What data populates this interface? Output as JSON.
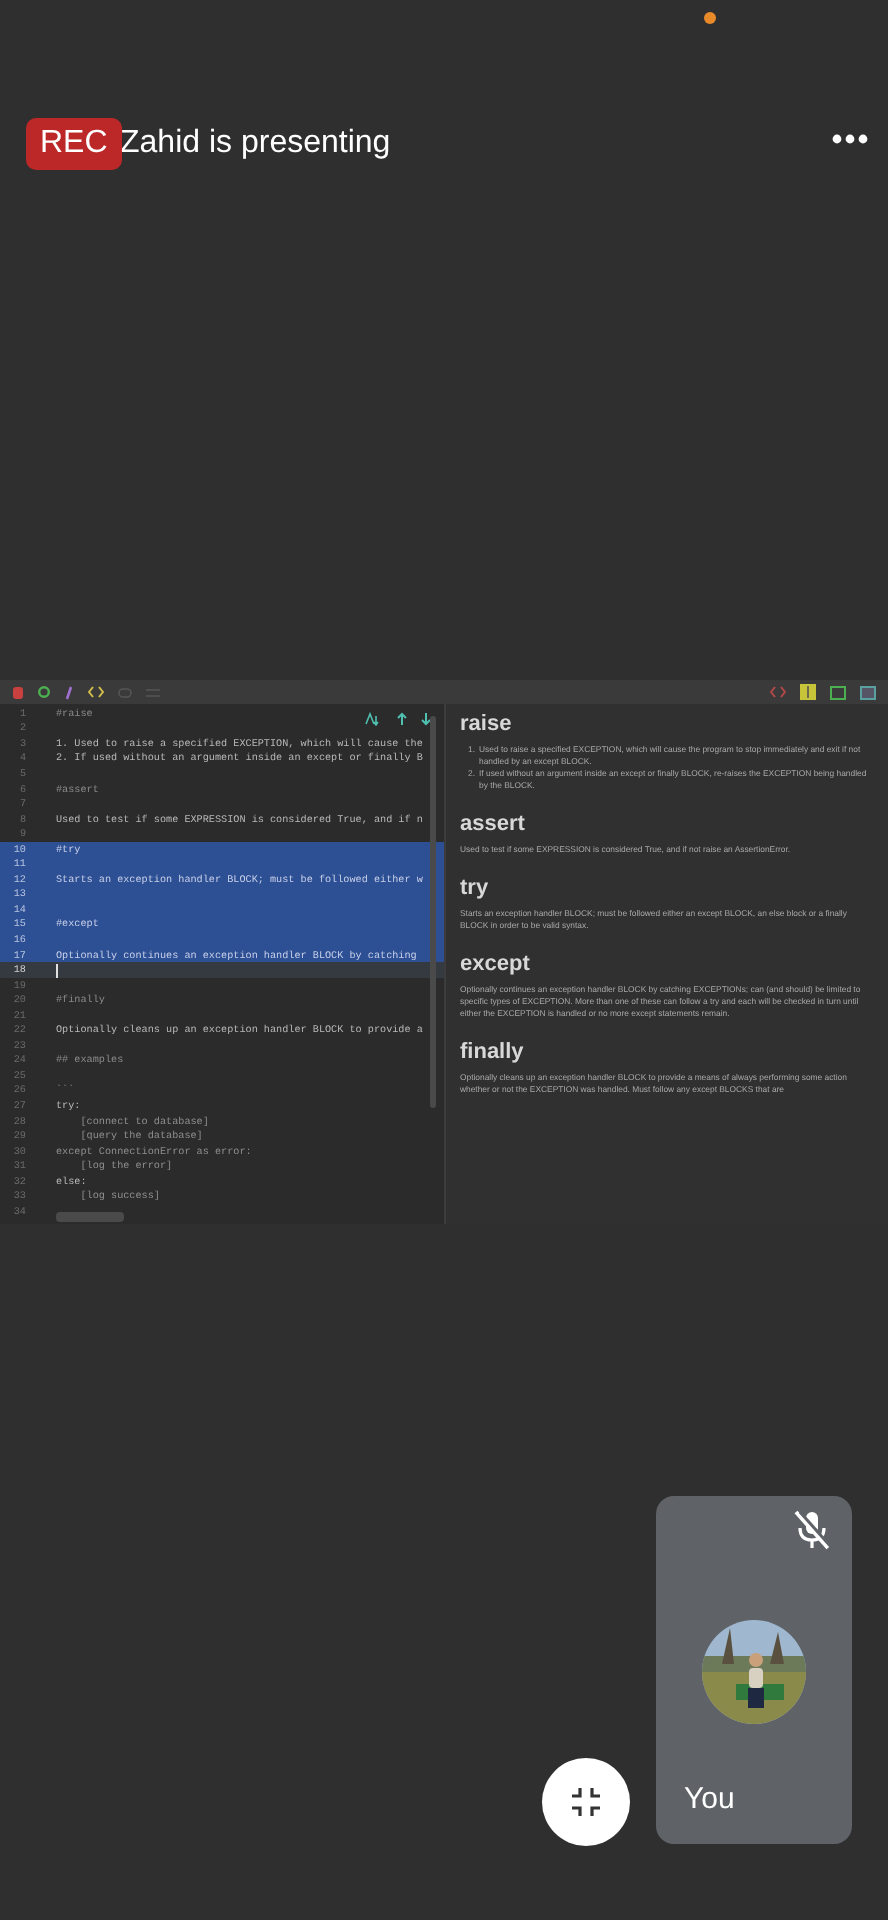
{
  "header": {
    "rec_badge": "REC",
    "presenter": "Zahid is presenting"
  },
  "editor": {
    "lines": [
      {
        "number": "1",
        "text": "#raise",
        "kind": "heading",
        "selected": false,
        "cursor": false
      },
      {
        "number": "2",
        "kind": "blank",
        "selected": false,
        "cursor": false
      },
      {
        "number": "3",
        "text": "1. Used to raise a specified EXCEPTION, which will cause the",
        "kind": "text",
        "selected": false,
        "cursor": false
      },
      {
        "number": "4",
        "text": "2. If used without an argument inside an except or finally B",
        "kind": "text",
        "selected": false,
        "cursor": false
      },
      {
        "number": "5",
        "kind": "blank",
        "selected": false,
        "cursor": false
      },
      {
        "number": "6",
        "text": "#assert",
        "kind": "heading",
        "selected": false,
        "cursor": false
      },
      {
        "number": "7",
        "kind": "blank",
        "selected": false,
        "cursor": false
      },
      {
        "number": "8",
        "text": "Used to test if some EXPRESSION is considered True, and if n",
        "kind": "text",
        "selected": false,
        "cursor": false
      },
      {
        "number": "9",
        "kind": "blank",
        "selected": false,
        "cursor": false
      },
      {
        "number": "10",
        "text": "#try",
        "kind": "heading",
        "selected": true,
        "cursor": false
      },
      {
        "number": "11",
        "kind": "blank",
        "selected": true,
        "cursor": false
      },
      {
        "number": "12",
        "text": "Starts an exception handler BLOCK; must be followed either w",
        "kind": "text",
        "selected": true,
        "cursor": false
      },
      {
        "number": "13",
        "kind": "blank",
        "selected": true,
        "cursor": false
      },
      {
        "number": "14",
        "kind": "blank",
        "selected": true,
        "cursor": false
      },
      {
        "number": "15",
        "text": "#except",
        "kind": "heading",
        "selected": true,
        "cursor": false
      },
      {
        "number": "16",
        "kind": "blank",
        "selected": true,
        "cursor": false
      },
      {
        "number": "17",
        "text": "Optionally continues an exception handler BLOCK by catching",
        "kind": "text",
        "selected": true,
        "cursor": false
      },
      {
        "number": "18",
        "kind": "blank",
        "selected": false,
        "cursor": true
      },
      {
        "number": "19",
        "kind": "blank",
        "selected": false,
        "cursor": false
      },
      {
        "number": "20",
        "text": "#finally",
        "kind": "heading",
        "selected": false,
        "cursor": false
      },
      {
        "number": "21",
        "kind": "blank",
        "selected": false,
        "cursor": false
      },
      {
        "number": "22",
        "text": "Optionally cleans up an exception handler BLOCK to provide a",
        "kind": "text",
        "selected": false,
        "cursor": false
      },
      {
        "number": "23",
        "kind": "blank",
        "selected": false,
        "cursor": false
      },
      {
        "number": "24",
        "text": "## examples",
        "kind": "heading",
        "selected": false,
        "cursor": false
      },
      {
        "number": "25",
        "kind": "blank",
        "selected": false,
        "cursor": false
      },
      {
        "number": "26",
        "text": "```",
        "kind": "code",
        "selected": false,
        "cursor": false
      },
      {
        "number": "27",
        "text": "try:",
        "kind": "text",
        "selected": false,
        "cursor": false
      },
      {
        "number": "28",
        "text": "    [connect to database]",
        "kind": "code",
        "selected": false,
        "cursor": false
      },
      {
        "number": "29",
        "text": "    [query the database]",
        "kind": "code",
        "selected": false,
        "cursor": false
      },
      {
        "number": "30",
        "text": "except ConnectionError as error:",
        "kind": "code",
        "selected": false,
        "cursor": false
      },
      {
        "number": "31",
        "text": "    [log the error]",
        "kind": "code",
        "selected": false,
        "cursor": false
      },
      {
        "number": "32",
        "text": "else:",
        "kind": "text",
        "selected": false,
        "cursor": false
      },
      {
        "number": "33",
        "text": "    [log success]",
        "kind": "code",
        "selected": false,
        "cursor": false
      },
      {
        "number": "34",
        "kind": "blank",
        "selected": false,
        "cursor": false
      }
    ]
  },
  "preview": {
    "sections": [
      {
        "title": "raise",
        "kind": "list",
        "items": [
          {
            "number": "1.",
            "text": "Used to raise a specified EXCEPTION, which will cause the program to stop immediately and exit if not handled by an except BLOCK."
          },
          {
            "number": "2.",
            "text": "If used without an argument inside an except or finally BLOCK, re-raises the EXCEPTION being handled by the BLOCK."
          }
        ]
      },
      {
        "title": "assert",
        "kind": "paragraph",
        "text": "Used to test if some EXPRESSION is considered True, and if not raise an AssertionError."
      },
      {
        "title": "try",
        "kind": "paragraph",
        "text": "Starts an exception handler BLOCK; must be followed either an except BLOCK, an else block or a finally BLOCK in order to be valid syntax."
      },
      {
        "title": "except",
        "kind": "paragraph",
        "text": "Optionally continues an exception handler BLOCK by catching EXCEPTIONs; can (and should) be limited to specific types of EXCEPTION. More than one of these can follow a try and each will be checked in turn until either the EXCEPTION is handled or no more except statements remain."
      },
      {
        "title": "finally",
        "kind": "paragraph",
        "text": "Optionally cleans up an exception handler BLOCK to provide a means of always performing some action whether or not the EXCEPTION was handled. Must follow any except BLOCKS that are"
      }
    ]
  },
  "self_tile": {
    "label": "You",
    "muted": true
  }
}
